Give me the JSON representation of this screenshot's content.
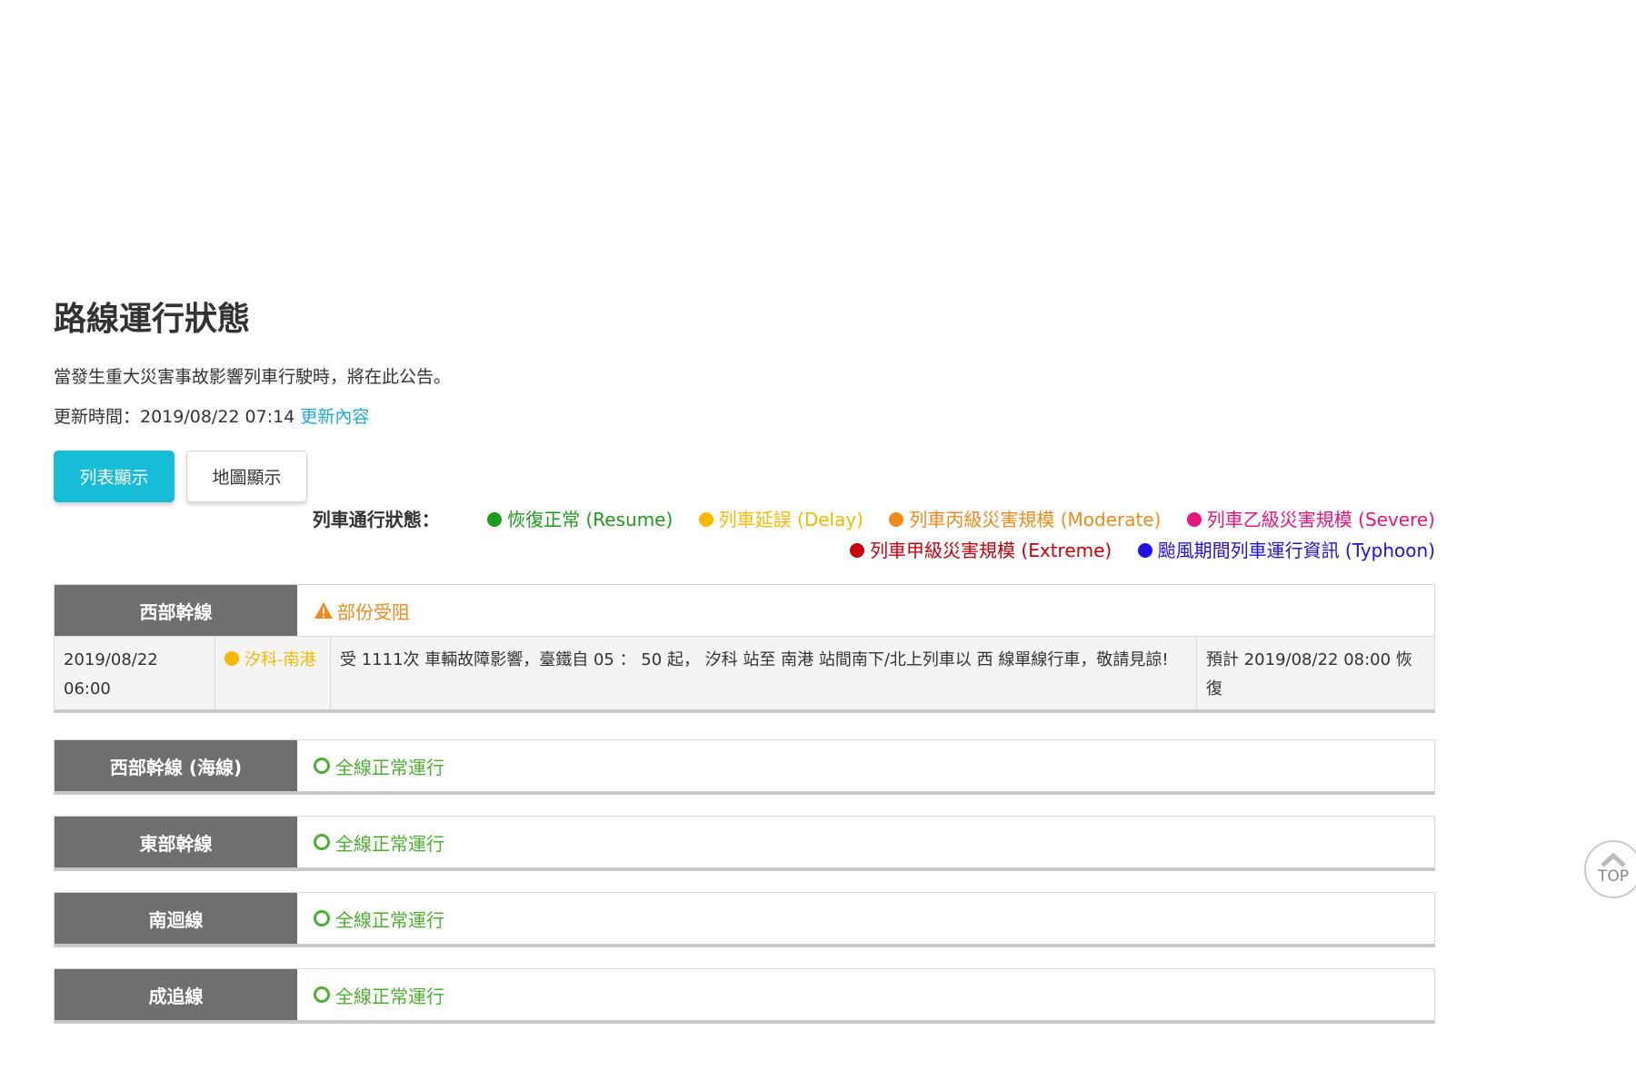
{
  "page": {
    "title": "路線運行狀態",
    "description": "當發生重大災害事故影響列車行駛時，將在此公告。",
    "update_label": "更新時間：2019/08/22 07:14",
    "update_link": "更新內容"
  },
  "tabs": {
    "list": "列表顯示",
    "map": "地圖顯示"
  },
  "legend": {
    "label": "列車通行狀態：",
    "items": [
      {
        "text": "恢復正常 (Resume)",
        "color": "#1f9a1f"
      },
      {
        "text": "列車延誤 (Delay)",
        "color": "#f6b800"
      },
      {
        "text": "列車丙級災害規模 (Moderate)",
        "color": "#f08a1c"
      },
      {
        "text": "列車乙級災害規模 (Severe)",
        "color": "#e8157f"
      },
      {
        "text": "列車甲級災害規模 (Extreme)",
        "color": "#c8000b"
      },
      {
        "text": "颱風期間列車運行資訊 (Typhoon)",
        "color": "#2010e8"
      }
    ]
  },
  "lines": [
    {
      "name": "西部幹線",
      "status": "部份受阻",
      "detail": {
        "time": "2019/08/22 06:00",
        "section": "汐科-南港",
        "message": "受 1111次 車輛故障影響，臺鐵自 05 ： 50 起， 汐科 站至 南港 站間南下/北上列車以 西 線單線行車，敬請見諒!",
        "eta": "預計 2019/08/22 08:00 恢復"
      }
    },
    {
      "name": "西部幹線 (海線)",
      "status": "全線正常運行"
    },
    {
      "name": "東部幹線",
      "status": "全線正常運行"
    },
    {
      "name": "南迴線",
      "status": "全線正常運行"
    },
    {
      "name": "成追線",
      "status": "全線正常運行"
    }
  ],
  "top_button": "TOP",
  "colors": {
    "accent": "#17bdd7",
    "header_gray": "#6f6f6f",
    "normal": "#4caf30",
    "partial": "#f08a1c"
  }
}
